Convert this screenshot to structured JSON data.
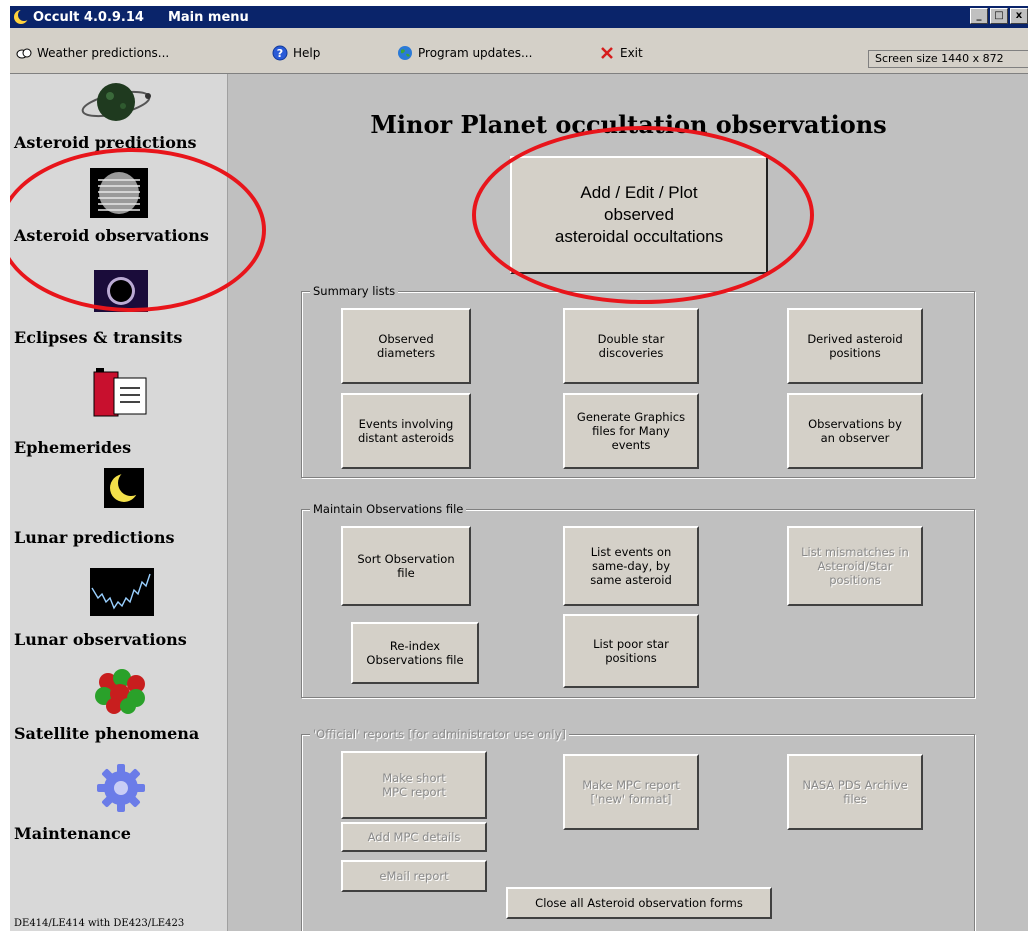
{
  "window": {
    "app_title": "Occult 4.0.9.14",
    "form_title": "Main menu",
    "controls": [
      "_",
      "□",
      "x"
    ]
  },
  "menubar": {
    "weather": "Weather predictions...",
    "help": "Help",
    "updates": "Program updates...",
    "exit": "Exit",
    "screen_size": "Screen size 1440 x 872"
  },
  "sidebar": {
    "items": [
      {
        "label": "Asteroid predictions",
        "icon": "asteroid-orbit-icon"
      },
      {
        "label": "Asteroid observations",
        "icon": "asteroid-chord-icon"
      },
      {
        "label": "Eclipses & transits",
        "icon": "solar-eclipse-icon"
      },
      {
        "label": "Ephemerides",
        "icon": "ephemeris-book-icon"
      },
      {
        "label": "Lunar predictions",
        "icon": "moon-crescent-icon"
      },
      {
        "label": "Lunar observations",
        "icon": "lightcurve-icon"
      },
      {
        "label": "Satellite phenomena",
        "icon": "satellite-cluster-icon"
      },
      {
        "label": "Maintenance",
        "icon": "gear-icon"
      }
    ],
    "footer": "DE414/LE414 with DE423/LE423"
  },
  "main": {
    "title": "Minor Planet occultation observations",
    "primary_button": "Add / Edit / Plot\nobserved\nasteroidal occultations",
    "summary": {
      "legend": "Summary lists",
      "buttons": [
        "Observed\ndiameters",
        "Double star\ndiscoveries",
        "Derived asteroid\npositions",
        "Events involving\ndistant asteroids",
        "Generate Graphics\nfiles for Many\nevents",
        "Observations by\nan observer"
      ]
    },
    "maintain": {
      "legend": "Maintain Observations file",
      "buttons": [
        "Sort Observation\nfile",
        "List events on\nsame-day, by\nsame asteroid",
        "List mismatches in\nAsteroid/Star\npositions",
        "Re-index\nObservations file",
        "List poor star\npositions"
      ]
    },
    "official": {
      "legend": "'Official' reports   [for administrator use only]",
      "buttons": [
        "Make short\nMPC report",
        "Make MPC report\n['new' format]",
        "NASA PDS Archive\nfiles",
        "Add MPC details",
        "eMail report"
      ]
    },
    "close_button": "Close all Asteroid observation forms"
  },
  "colors": {
    "titlebar": "#0a246a",
    "window_bg": "#c0c0c0",
    "annotation": "#e8151b",
    "disabled_text": "#8a8a8a"
  }
}
